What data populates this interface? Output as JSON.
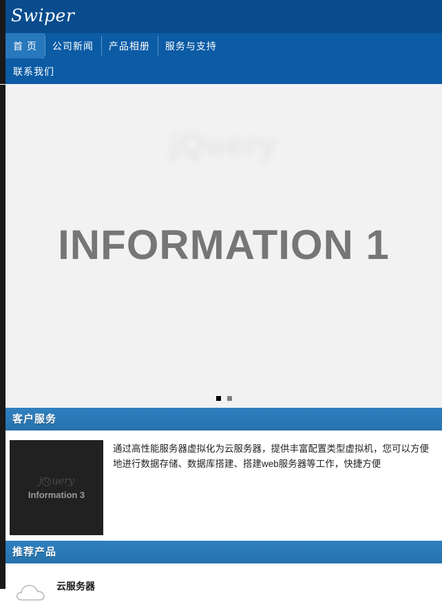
{
  "site": {
    "brand": "Swiper"
  },
  "nav": {
    "items": [
      {
        "label": "首 页",
        "active": true
      },
      {
        "label": "公司新闻",
        "active": false
      },
      {
        "label": "产品相册",
        "active": false
      },
      {
        "label": "服务与支持",
        "active": false
      },
      {
        "label": "联系我们",
        "active": false
      }
    ]
  },
  "slider": {
    "current_slide_title": "INFORMATION 1",
    "watermark_text": "jQuery",
    "bullets": [
      {
        "label": "1",
        "active": true
      },
      {
        "label": "2",
        "active": false
      }
    ]
  },
  "sections": [
    {
      "title": "客户服务",
      "thumb": {
        "watermark": "jQuery",
        "label": "Information 3"
      },
      "text": "通过高性能服务器虚拟化为云服务器，提供丰富配置类型虚拟机，您可以方便地进行数据存储、数据库搭建、搭建web服务器等工作，快捷方便"
    },
    {
      "title": "推荐产品",
      "products": [
        {
          "name": "云服务器",
          "icon": "cloud-icon"
        }
      ]
    }
  ],
  "colors": {
    "header_blue": "#084c8d",
    "nav_blue": "#0b5ba5",
    "nav_active_blue": "#2878bd",
    "section_blue": "#2878b5",
    "slider_bg": "#f2f2f2",
    "slide_title_gray": "#767676",
    "rail_dark": "#191919",
    "thumb_dark": "#212121"
  }
}
